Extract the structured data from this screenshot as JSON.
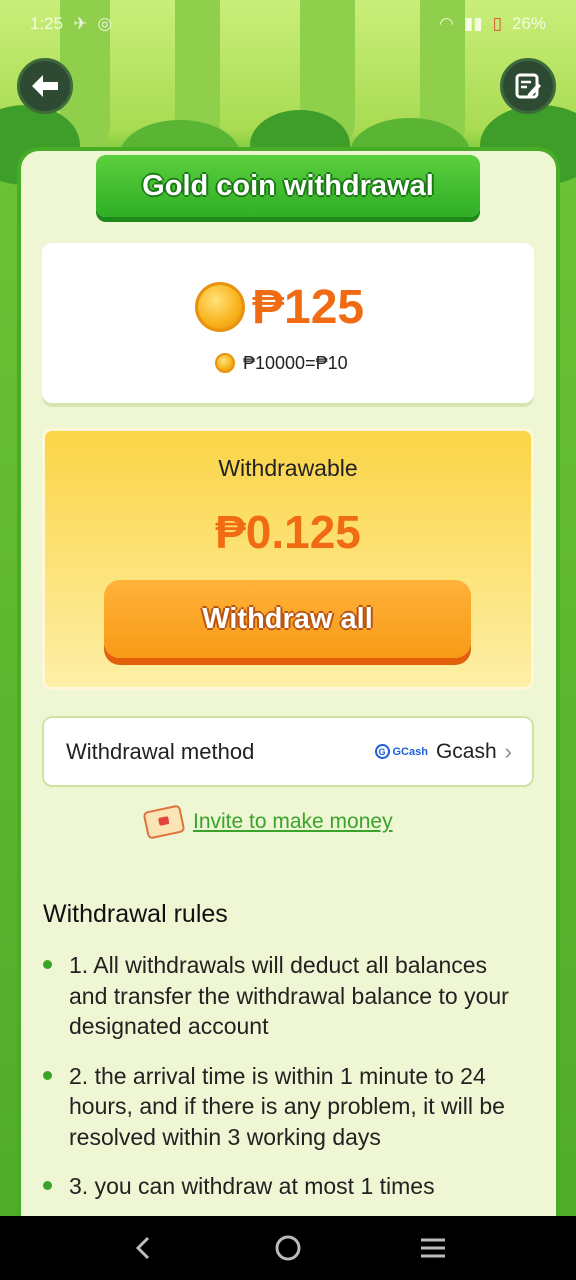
{
  "status_bar": {
    "time": "1:25",
    "battery": "26%"
  },
  "header": {
    "back_icon": "back-arrow-icon",
    "edit_icon": "edit-note-icon"
  },
  "title": "Gold coin withdrawal",
  "balance": {
    "amount": "₱125",
    "rate": "₱10000=₱10"
  },
  "withdraw": {
    "label": "Withdrawable",
    "amount": "₱0.125",
    "button_label": "Withdraw all"
  },
  "method": {
    "label": "Withdrawal method",
    "logo_text": "GCash",
    "value": "Gcash"
  },
  "invite": {
    "label": "Invite to make money"
  },
  "rules": {
    "title": "Withdrawal rules",
    "items": [
      "1. All withdrawals will deduct all balances and transfer the withdrawal balance to your designated account",
      "2. the arrival time is within 1 minute to 24 hours, and if there is any problem, it will be resolved within 3 working days",
      "3. you can withdraw at most 1 times"
    ]
  },
  "colors": {
    "accent_green": "#3aa32a",
    "amount_orange": "#f06b12",
    "button_orange": "#f79a16"
  }
}
